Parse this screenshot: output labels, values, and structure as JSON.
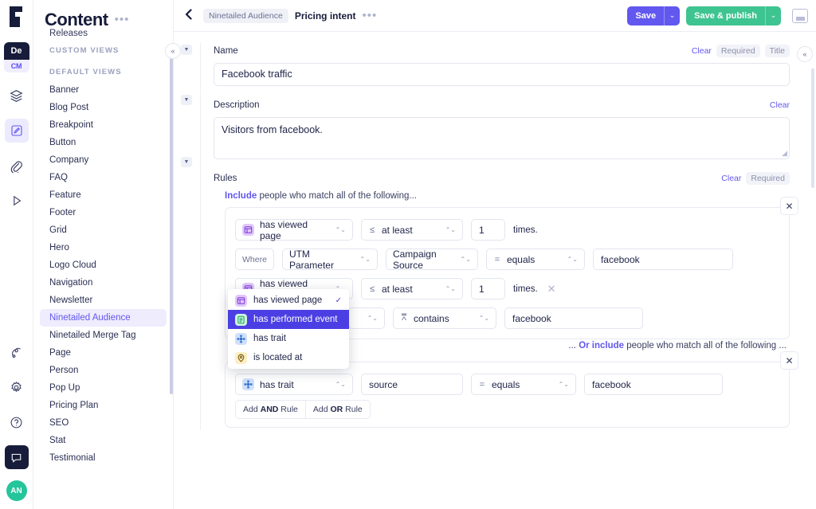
{
  "rail": {
    "logo_icon": "gatsby-logo-icon",
    "badge": {
      "top": "De",
      "bottom": "CM"
    },
    "items": [
      {
        "name": "layers-icon",
        "glyph": "≣"
      },
      {
        "name": "compose-icon",
        "glyph": "✎"
      },
      {
        "name": "paperclip-icon",
        "glyph": "📎"
      },
      {
        "name": "play-icon",
        "glyph": "▷"
      },
      {
        "name": "api-icon",
        "glyph": "⑂"
      },
      {
        "name": "gear-icon",
        "glyph": "⚙"
      },
      {
        "name": "help-icon",
        "glyph": "?"
      },
      {
        "name": "chat-icon",
        "glyph": "▢"
      }
    ],
    "avatar_initials": "AN"
  },
  "sidebar": {
    "title": "Content",
    "more_label": "•••",
    "collapse_label": "«",
    "partial_top_item": "Releases",
    "groups": [
      {
        "label": "Custom Views",
        "items": []
      },
      {
        "label": "Default Views",
        "items": [
          {
            "label": "Banner",
            "selected": false
          },
          {
            "label": "Blog Post",
            "selected": false
          },
          {
            "label": "Breakpoint",
            "selected": false
          },
          {
            "label": "Button",
            "selected": false
          },
          {
            "label": "Company",
            "selected": false
          },
          {
            "label": "FAQ",
            "selected": false
          },
          {
            "label": "Feature",
            "selected": false
          },
          {
            "label": "Footer",
            "selected": false
          },
          {
            "label": "Grid",
            "selected": false
          },
          {
            "label": "Hero",
            "selected": false
          },
          {
            "label": "Logo Cloud",
            "selected": false
          },
          {
            "label": "Navigation",
            "selected": false
          },
          {
            "label": "Newsletter",
            "selected": false
          },
          {
            "label": "Ninetailed Audience",
            "selected": true
          },
          {
            "label": "Ninetailed Merge Tag",
            "selected": false
          },
          {
            "label": "Page",
            "selected": false
          },
          {
            "label": "Person",
            "selected": false
          },
          {
            "label": "Pop Up",
            "selected": false
          },
          {
            "label": "Pricing Plan",
            "selected": false
          },
          {
            "label": "SEO",
            "selected": false
          },
          {
            "label": "Stat",
            "selected": false
          },
          {
            "label": "Testimonial",
            "selected": false
          }
        ]
      }
    ]
  },
  "topbar": {
    "back_label": "‹",
    "breadcrumb_chip": "Ninetailed Audience",
    "breadcrumb_title": "Pricing intent",
    "more_label": "•••",
    "save_label": "Save",
    "save_caret": "⌄",
    "publish_label": "Save & publish",
    "publish_caret": "⌄",
    "window_icon": "minimize-icon",
    "colors": {
      "save": "#6257ef",
      "publish": "#3ec490"
    }
  },
  "right_collapse_label": "«",
  "fields": {
    "name": {
      "label": "Name",
      "value": "Facebook traffic",
      "clear_label": "Clear",
      "required_label": "Required",
      "title_label": "Title",
      "twisty": "▼"
    },
    "description": {
      "label": "Description",
      "value": "Visitors from facebook.",
      "clear_label": "Clear",
      "twisty": "▼"
    },
    "rules": {
      "label": "Rules",
      "clear_label": "Clear",
      "required_label": "Required",
      "twisty": "▼",
      "intro_bold": "Include",
      "intro_rest": " people who match all of the following...",
      "or_prefix": "... ",
      "or_bold": "Or include",
      "or_rest": " people who match all of the following ...",
      "close_label": "✕",
      "row_remove_label": "✕",
      "add_and": {
        "pre": "Add ",
        "bold": "AND",
        "post": " Rule"
      },
      "add_or": {
        "pre": "Add ",
        "bold": "OR",
        "post": " Rule"
      },
      "group1": {
        "rows": [
          {
            "kind": "event-count",
            "subject": {
              "icon": "page-view-icon",
              "icon_class": "ic-page",
              "glyph": "▤",
              "label": "has viewed page"
            },
            "operator": {
              "symbol": "≤",
              "label": "at least"
            },
            "count": "1",
            "suffix": "times.",
            "removable": false
          },
          {
            "kind": "where",
            "where_label": "Where",
            "param_type": "UTM Parameter",
            "param_name": "Campaign Source",
            "comparator": {
              "symbol": "=",
              "label": "equals"
            },
            "value": "facebook"
          },
          {
            "kind": "event-count",
            "subject": {
              "icon": "page-view-icon",
              "icon_class": "ic-page",
              "glyph": "▤",
              "label": "has viewed page"
            },
            "operator": {
              "symbol": "≤",
              "label": "at least"
            },
            "count": "1",
            "suffix": "times.",
            "removable": true
          },
          {
            "kind": "where-open",
            "comparator": {
              "symbol": "⩞",
              "label": "contains"
            },
            "value": "facebook"
          }
        ],
        "dropdown": {
          "open": true,
          "options": [
            {
              "label": "has viewed page",
              "icon": "page-view-icon",
              "icon_class": "ic-page",
              "glyph": "▤",
              "checked": true,
              "highlighted": false
            },
            {
              "label": "has performed event",
              "icon": "event-icon",
              "icon_class": "ic-event",
              "glyph": "▥",
              "checked": false,
              "highlighted": true
            },
            {
              "label": "has trait",
              "icon": "trait-icon",
              "icon_class": "ic-trait",
              "glyph": "❈",
              "checked": false,
              "highlighted": false
            },
            {
              "label": "is located at",
              "icon": "location-pin-icon",
              "icon_class": "ic-geo",
              "glyph": "◉",
              "checked": false,
              "highlighted": false
            }
          ],
          "check_glyph": "✓"
        }
      },
      "group2": {
        "rows": [
          {
            "kind": "trait",
            "subject": {
              "icon": "trait-icon",
              "icon_class": "ic-trait",
              "glyph": "❈",
              "label": "has trait"
            },
            "trait_key": "source",
            "comparator": {
              "symbol": "=",
              "label": "equals"
            },
            "value": "facebook"
          }
        ]
      }
    }
  },
  "stepper_glyph": "⌃⌄"
}
